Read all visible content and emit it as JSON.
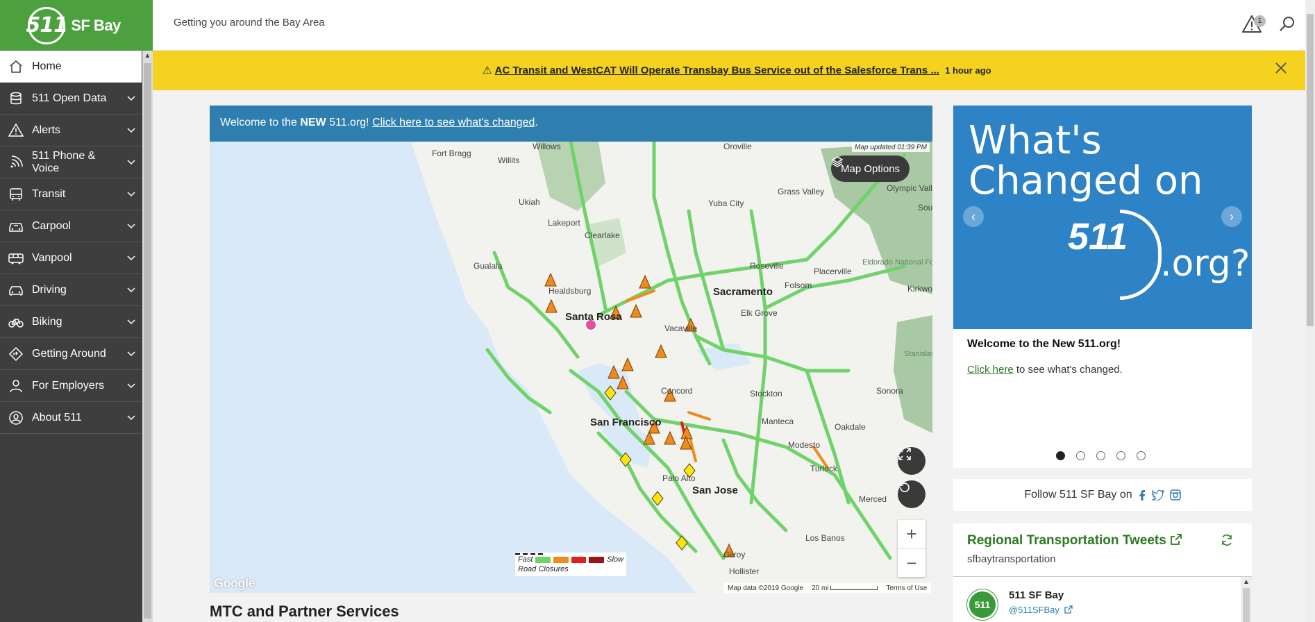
{
  "brand": {
    "logo_mark": "511",
    "logo_text": "SF Bay"
  },
  "header": {
    "tagline": "Getting you around the Bay Area",
    "alert_count": "1"
  },
  "banner": {
    "link_text": "AC Transit and WestCAT Will Operate Transbay Bus Service out of the Salesforce Trans ...",
    "time": "1 hour ago"
  },
  "sidebar": {
    "items": [
      {
        "label": "Home"
      },
      {
        "label": "511 Open Data"
      },
      {
        "label": "Alerts"
      },
      {
        "label": "511 Phone & Voice"
      },
      {
        "label": "Transit"
      },
      {
        "label": "Carpool"
      },
      {
        "label": "Vanpool"
      },
      {
        "label": "Driving"
      },
      {
        "label": "Biking"
      },
      {
        "label": "Getting Around"
      },
      {
        "label": "For Employers"
      },
      {
        "label": "About 511"
      }
    ]
  },
  "welcome": {
    "prefix": "Welcome to the ",
    "bold": "NEW",
    "middle": " 511.org! ",
    "link": "Click here to see what's changed",
    "suffix": "."
  },
  "map": {
    "updated": "Map updated 01:39 PM",
    "options_label": "Map Options",
    "legend": {
      "fast": "Fast",
      "slow": "Slow",
      "closures": "Road Closures"
    },
    "google": "Google",
    "map_data": "Map data ©2019 Google",
    "scale": "20 mi",
    "terms": "Terms of Use",
    "places": {
      "fort_bragg": "Fort Bragg",
      "willits": "Willits",
      "ukiah": "Ukiah",
      "lakeport": "Lakeport",
      "clearlake": "Clearlake",
      "gualala": "Gualala",
      "healdsburg": "Healdsburg",
      "santa_rosa": "Santa Rosa",
      "vacaville": "Vacaville",
      "sacramento": "Sacramento",
      "roseville": "Roseville",
      "folsom": "Folsom",
      "placerville": "Placerville",
      "yuba_city": "Yuba City",
      "oroville": "Oroville",
      "grass_valley": "Grass Valley",
      "elk_grove": "Elk Grove",
      "concord": "Concord",
      "stockton": "Stockton",
      "san_francisco": "San Francisco",
      "manteca": "Manteca",
      "modesto": "Modesto",
      "oakdale": "Oakdale",
      "sonora": "Sonora",
      "turlock": "Turlock",
      "palo_alto": "Palo Alto",
      "san_jose": "San Jose",
      "merced": "Merced",
      "los_banos": "Los Banos",
      "gilroy": "Gilroy",
      "hollister": "Hollister",
      "willows": "Willows",
      "olympic_valley": "Olympic Valley",
      "eldorado": "Eldorado National Forest",
      "kirkwood": "Kirkwood",
      "stanislaus": "Stanislaus National",
      "south": "South"
    }
  },
  "section": {
    "title": "MTC and Partner Services"
  },
  "carousel": {
    "title_line1": "What's",
    "title_line2": "Changed on",
    "logo": "511",
    "org": ".org?",
    "heading": "Welcome to the New 511.org!",
    "link": "Click here",
    "text": " to see what's changed.",
    "slides": 5,
    "active": 0
  },
  "follow": {
    "text": "Follow 511 SF Bay on"
  },
  "tweets": {
    "title": "Regional Transportation Tweets",
    "subtitle": "sfbaytransportation",
    "name": "511 SF Bay",
    "handle": "@511SFBay",
    "avatar": "511"
  },
  "colors": {
    "brand_green": "#4ca13e",
    "banner_yellow": "#f4d21f",
    "welcome_blue": "#2e7eaf",
    "carousel_blue": "#2e82c6",
    "fast": "#6fd36a",
    "medium": "#f08a1c",
    "slow": "#e02020",
    "slowest": "#9a1515"
  }
}
